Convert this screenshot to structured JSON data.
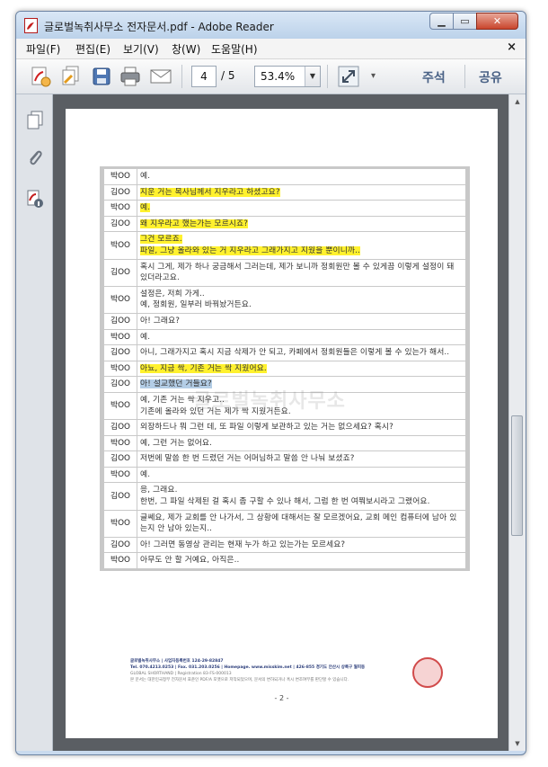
{
  "window": {
    "title": "글로벌녹취사무소 전자문서.pdf - Adobe Reader",
    "min_glyph": "▁",
    "max_glyph": "▭",
    "close_glyph": "✕"
  },
  "menu": {
    "items": [
      "파일(F)",
      "편집(E)",
      "보기(V)",
      "창(W)",
      "도움말(H)"
    ],
    "close_glyph": "×"
  },
  "toolbar": {
    "page_current": "4",
    "page_total": "/ 5",
    "zoom": "53.4%",
    "zoom_arrow": "▼",
    "more_glyph": "▾",
    "comment": "주석",
    "share": "공유"
  },
  "scrollbar": {
    "up": "▲",
    "down": "▼"
  },
  "document": {
    "watermark": "글로벌녹취사무소",
    "rows": [
      {
        "speaker": "박OO",
        "text": "예.",
        "hl": ""
      },
      {
        "speaker": "김OO",
        "text": "지운 거는 목사님께서 지우라고 하셨고요?",
        "hl": "y"
      },
      {
        "speaker": "박OO",
        "text": "예.",
        "hl": "y"
      },
      {
        "speaker": "김OO",
        "text": "왜 지우라고 했는가는 모르시죠?",
        "hl": "y"
      },
      {
        "speaker": "박OO",
        "text": "그건 모르죠.\n파일, 그냥 올라와 있는 거 지우라고 그래가지고 지웠을 뿐이니까..",
        "hl": "y"
      },
      {
        "speaker": "김OO",
        "text": "혹시 그게, 제가 하나 궁금해서 그러는데, 제가 보니까 정회원만 볼 수 있게끔 이렇게 설정이 돼 있더라고요.",
        "hl": ""
      },
      {
        "speaker": "박OO",
        "text": "설정은, 저희 가게..\n예, 정회원, 일부러 바꿔놨거든요.",
        "hl": ""
      },
      {
        "speaker": "김OO",
        "text": "아! 그래요?",
        "hl": ""
      },
      {
        "speaker": "박OO",
        "text": "예.",
        "hl": ""
      },
      {
        "speaker": "김OO",
        "text": "아니, 그래가지고 혹시 지금 삭제가 안 되고, 카페에서 정회원들은 이렇게 볼 수 있는가 해서..",
        "hl": ""
      },
      {
        "speaker": "박OO",
        "text": "아뇨, 지금 싹, 기존 거는 싹 지웠어요.",
        "hl": "y"
      },
      {
        "speaker": "김OO",
        "text": "아! 설교했던 거들요?",
        "hl": "b"
      },
      {
        "speaker": "박OO",
        "text": "예, 기존 거는 싹 지우고..\n기존에 올라와 있던 거는 제가 싹 지웠거든요.",
        "hl": ""
      },
      {
        "speaker": "김OO",
        "text": "외장하드나 뭐 그런 데, 또 파일 이렇게 보관하고 있는 거는 없으세요? 혹시?",
        "hl": ""
      },
      {
        "speaker": "박OO",
        "text": "예, 그런 거는 없어요.",
        "hl": ""
      },
      {
        "speaker": "김OO",
        "text": "저번에 말씀 한 번 드렸던 거는 어머님하고 말씀 안 나눠 보셨죠?",
        "hl": ""
      },
      {
        "speaker": "박OO",
        "text": "예.",
        "hl": ""
      },
      {
        "speaker": "김OO",
        "text": "응, 그래요.\n한번, 그 파일 삭제된 걸 혹시 좀 구할 수 있나 해서, 그럼 한 번 여쭤보시라고 그랬어요.",
        "hl": ""
      },
      {
        "speaker": "박OO",
        "text": "글쎄요, 제가 교회를 안 나가서, 그 상황에 대해서는 잘 모르겠어요, 교회 메인 컴퓨터에 남아 있는지 안 남아 있는지..",
        "hl": ""
      },
      {
        "speaker": "김OO",
        "text": "아! 그러면 동영상 관리는 현재 누가 하고 있는가는 모르세요?",
        "hl": ""
      },
      {
        "speaker": "박OO",
        "text": "아무도 안 할 거예요, 아직은..",
        "hl": ""
      }
    ],
    "footer_line1": "글로벌녹취사무소 | 사업자등록번호 124-29-82847",
    "footer_line2": "Tel. 070.4213.0253 | Fax. 031.203.0256 | Homepage. www.misskim.net | 426-855 경기도 안산시 상록구 월피동",
    "footer_line3": "GLOBAL SHORTHAND | Registration 83-FS-000013",
    "footer_line4": "본 문서는 대한민국정부 전자문서 표준인 PDF/A 포맷으로 저작되었으며, 문서의 변하되거나 혹시 변조여부를 판단할 수 있습니다.",
    "page_label": "- 2 -"
  }
}
